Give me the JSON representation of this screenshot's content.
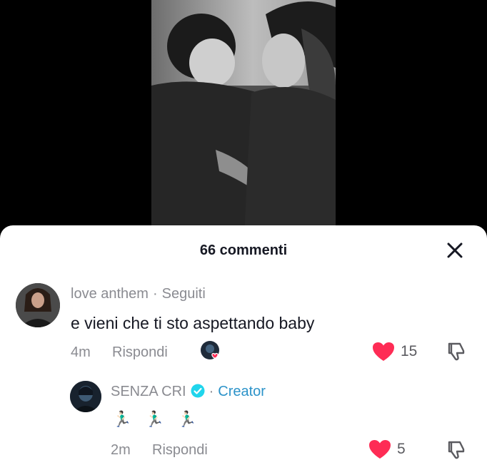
{
  "sheet": {
    "title": "66 commenti"
  },
  "comments": [
    {
      "username": "love anthem",
      "tag": "Seguiti",
      "text": "e vieni che ti sto aspettando baby",
      "time": "4m",
      "reply_label": "Rispondi",
      "likes": "15"
    },
    {
      "username": "SENZA CRI",
      "tag": "Creator",
      "text": "🏃🏻‍♂️ 🏃🏻‍♂️ 🏃🏻‍♂️",
      "time": "2m",
      "reply_label": "Rispondi",
      "likes": "5"
    }
  ],
  "colors": {
    "like": "#fe2c55",
    "creator": "#2c93c9",
    "muted": "#8a8b91"
  },
  "icons": [
    "close-icon",
    "heart-icon",
    "dislike-icon",
    "verified-icon"
  ]
}
